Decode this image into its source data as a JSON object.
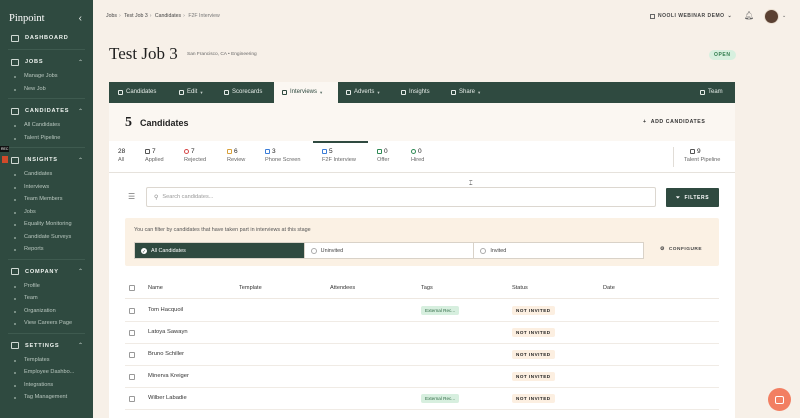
{
  "brand": "Pinpoint",
  "sidebar": {
    "sections": [
      {
        "label": "DASHBOARD",
        "icon": "dashboard-icon",
        "items": []
      },
      {
        "label": "JOBS",
        "icon": "briefcase-icon",
        "items": [
          "Manage Jobs",
          "New Job"
        ]
      },
      {
        "label": "CANDIDATES",
        "icon": "people-icon",
        "items": [
          "All Candidates",
          "Talent Pipeline"
        ]
      },
      {
        "label": "INSIGHTS",
        "icon": "chart-icon",
        "items": [
          "Candidates",
          "Interviews",
          "Team Members",
          "Jobs",
          "Equality Monitoring",
          "Candidate Surveys",
          "Reports"
        ]
      },
      {
        "label": "COMPANY",
        "icon": "building-icon",
        "items": [
          "Profile",
          "Team",
          "Organization",
          "View Careers Page"
        ]
      },
      {
        "label": "SETTINGS",
        "icon": "gear-icon",
        "items": [
          "Templates",
          "Employee Dashbo...",
          "Integrations",
          "Tag Management"
        ]
      }
    ],
    "rec_badge": "REC"
  },
  "breadcrumb": {
    "jobs": "Jobs",
    "job": "Test Job 3",
    "candidates": "Candidates",
    "current": "F2F Interview"
  },
  "org_switcher": "NOOLI WEBINAR DEMO",
  "job": {
    "title": "Test Job 3",
    "subtitle": "San Francisco, CA • Engineering",
    "status": "OPEN"
  },
  "nav": {
    "candidates": "Candidates",
    "edit": "Edit",
    "scorecards": "Scorecards",
    "interviews": "Interviews",
    "adverts": "Adverts",
    "insights": "Insights",
    "share": "Share",
    "team": "Team"
  },
  "candidates_header": {
    "count": "5",
    "label": "Candidates",
    "add": "ADD CANDIDATES"
  },
  "stages": {
    "all": {
      "num": "28",
      "name": "All"
    },
    "applied": {
      "num": "7",
      "name": "Applied"
    },
    "rejected": {
      "num": "7",
      "name": "Rejected"
    },
    "review": {
      "num": "6",
      "name": "Review"
    },
    "phone": {
      "num": "3",
      "name": "Phone Screen"
    },
    "f2f": {
      "num": "5",
      "name": "F2F Interview"
    },
    "offer": {
      "num": "0",
      "name": "Offer"
    },
    "hired": {
      "num": "0",
      "name": "Hired"
    },
    "talent": {
      "num": "9",
      "name": "Talent Pipeline"
    }
  },
  "stage_colors": {
    "applied": "#555555",
    "rejected": "#d64545",
    "review": "#d9a13b",
    "phone": "#3b7dd8",
    "f2f": "#3b7dd8",
    "offer": "#2f8a55",
    "hired": "#2f8a55",
    "talent": "#555555"
  },
  "search": {
    "placeholder": "Search candidates..."
  },
  "filters_label": "FILTERS",
  "filter_panel": {
    "text": "You can filter by candidates that have taken part in interviews at this stage",
    "options": [
      "All Candidates",
      "Uninvited",
      "Invited"
    ],
    "configure": "CONFIGURE"
  },
  "table": {
    "headers": {
      "name": "Name",
      "template": "Template",
      "attendees": "Attendees",
      "tags": "Tags",
      "status": "Status",
      "date": "Date"
    },
    "rows": [
      {
        "name": "Tom Hacquoil",
        "tag": "External Rec...",
        "status": "NOT INVITED"
      },
      {
        "name": "Latoya Sawayn",
        "tag": "",
        "status": "NOT INVITED"
      },
      {
        "name": "Bruno Schiller",
        "tag": "",
        "status": "NOT INVITED"
      },
      {
        "name": "Minerva Kreiger",
        "tag": "",
        "status": "NOT INVITED"
      },
      {
        "name": "Wilber Labadie",
        "tag": "External Rec...",
        "status": "NOT INVITED"
      }
    ]
  },
  "colors": {
    "brand_green": "#2f4a40",
    "accent_orange": "#f27f62",
    "open_green": "#2f7a4b"
  }
}
